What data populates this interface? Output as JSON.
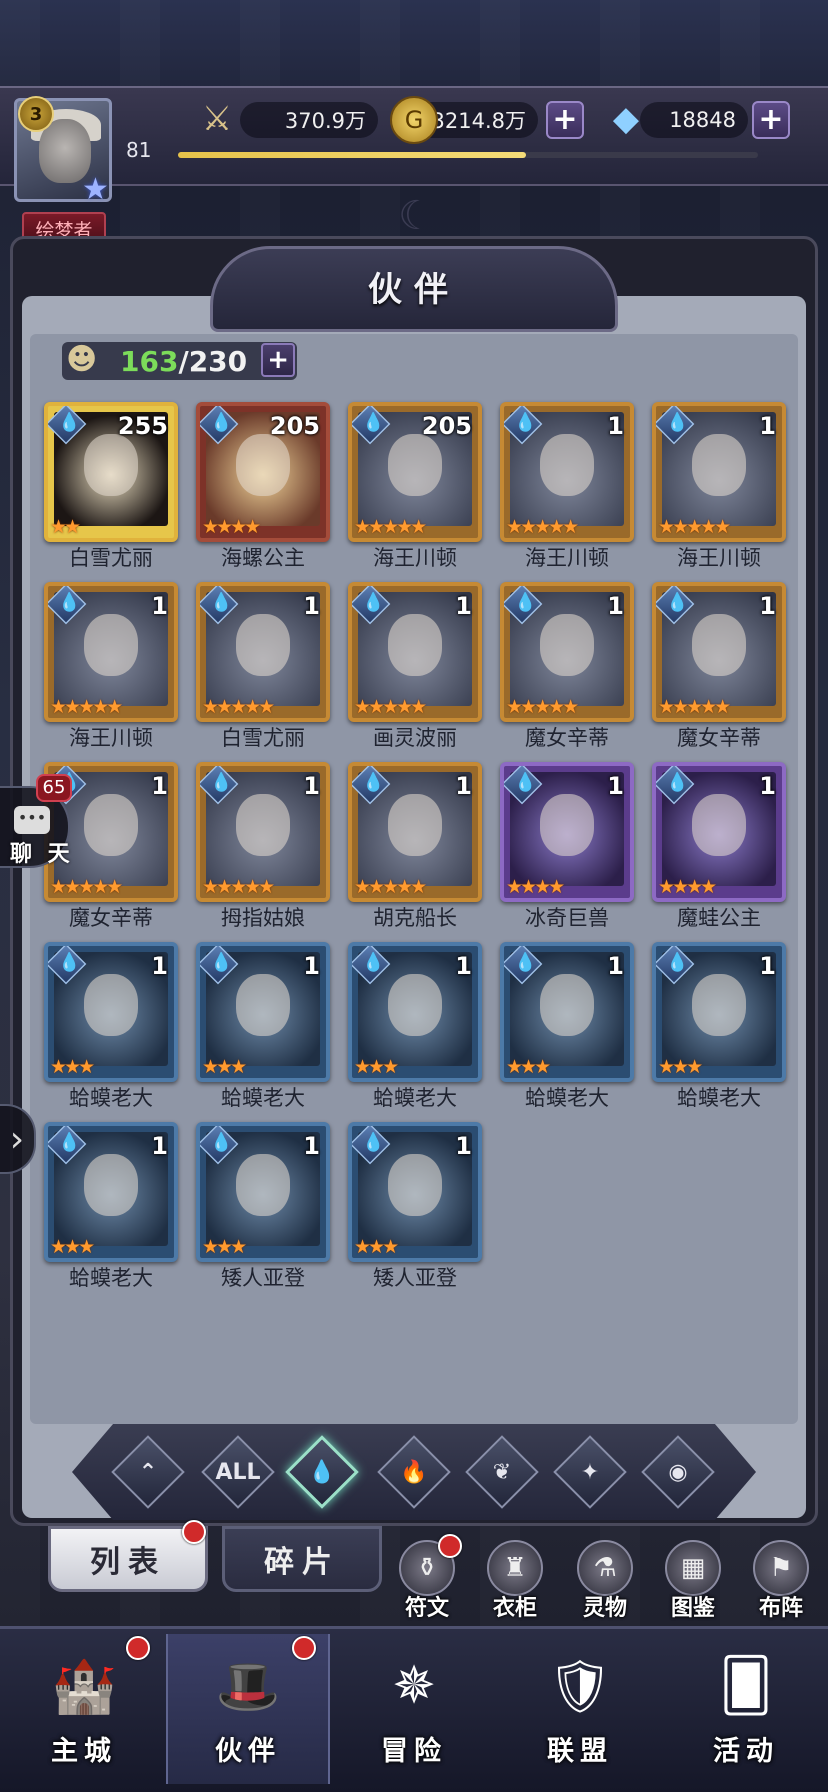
{
  "player": {
    "vip_level": "3",
    "level": "81",
    "title": "绘梦者",
    "xp_progress": 0.6
  },
  "resources": {
    "power": {
      "icon": "sword-icon",
      "value": "370.9万"
    },
    "gold": {
      "icon": "gold-coin-icon",
      "value": "3214.8万"
    },
    "gems": {
      "icon": "diamond-icon",
      "value": "18848"
    }
  },
  "panel": {
    "title": "伙伴",
    "capacity_current": "163",
    "capacity_separator": "/",
    "capacity_max": "230"
  },
  "heroes": [
    {
      "name": "白雪尤丽",
      "level": "255",
      "stars": 2,
      "rarity": "gold"
    },
    {
      "name": "海螺公主",
      "level": "205",
      "stars": 4,
      "rarity": "red"
    },
    {
      "name": "海王川顿",
      "level": "205",
      "stars": 5,
      "rarity": "orange"
    },
    {
      "name": "海王川顿",
      "level": "1",
      "stars": 5,
      "rarity": "orange"
    },
    {
      "name": "海王川顿",
      "level": "1",
      "stars": 5,
      "rarity": "orange"
    },
    {
      "name": "海王川顿",
      "level": "1",
      "stars": 5,
      "rarity": "orange"
    },
    {
      "name": "白雪尤丽",
      "level": "1",
      "stars": 5,
      "rarity": "orange"
    },
    {
      "name": "画灵波丽",
      "level": "1",
      "stars": 5,
      "rarity": "orange"
    },
    {
      "name": "魔女辛蒂",
      "level": "1",
      "stars": 5,
      "rarity": "orange"
    },
    {
      "name": "魔女辛蒂",
      "level": "1",
      "stars": 5,
      "rarity": "orange"
    },
    {
      "name": "魔女辛蒂",
      "level": "1",
      "stars": 5,
      "rarity": "orange"
    },
    {
      "name": "拇指姑娘",
      "level": "1",
      "stars": 5,
      "rarity": "orange"
    },
    {
      "name": "胡克船长",
      "level": "1",
      "stars": 5,
      "rarity": "orange"
    },
    {
      "name": "冰奇巨兽",
      "level": "1",
      "stars": 4,
      "rarity": "purple"
    },
    {
      "name": "魔蛙公主",
      "level": "1",
      "stars": 4,
      "rarity": "purple"
    },
    {
      "name": "蛤蟆老大",
      "level": "1",
      "stars": 3,
      "rarity": "blue"
    },
    {
      "name": "蛤蟆老大",
      "level": "1",
      "stars": 3,
      "rarity": "blue"
    },
    {
      "name": "蛤蟆老大",
      "level": "1",
      "stars": 3,
      "rarity": "blue"
    },
    {
      "name": "蛤蟆老大",
      "level": "1",
      "stars": 3,
      "rarity": "blue"
    },
    {
      "name": "蛤蟆老大",
      "level": "1",
      "stars": 3,
      "rarity": "blue"
    },
    {
      "name": "蛤蟆老大",
      "level": "1",
      "stars": 3,
      "rarity": "blue"
    },
    {
      "name": "矮人亚登",
      "level": "1",
      "stars": 3,
      "rarity": "blue"
    },
    {
      "name": "矮人亚登",
      "level": "1",
      "stars": 3,
      "rarity": "blue"
    }
  ],
  "chat": {
    "badge_count": "65",
    "label": "聊 天"
  },
  "filters": [
    {
      "icon": "wind-element-icon",
      "label": ""
    },
    {
      "icon": "all-filter-icon",
      "label": "ALL"
    },
    {
      "icon": "water-element-icon",
      "label": ""
    },
    {
      "icon": "fire-element-icon",
      "label": ""
    },
    {
      "icon": "nature-element-icon",
      "label": ""
    },
    {
      "icon": "light-element-icon",
      "label": ""
    },
    {
      "icon": "dark-element-icon",
      "label": ""
    }
  ],
  "tabs": {
    "list": "列表",
    "fragments": "碎片"
  },
  "shortcuts": [
    {
      "label": "符文",
      "icon": "rune-icon"
    },
    {
      "label": "衣柜",
      "icon": "wardrobe-icon"
    },
    {
      "label": "灵物",
      "icon": "spirit-icon"
    },
    {
      "label": "图鉴",
      "icon": "codex-icon"
    },
    {
      "label": "布阵",
      "icon": "formation-icon"
    }
  ],
  "nav": [
    {
      "label": "主城",
      "icon": "castle-icon"
    },
    {
      "label": "伙伴",
      "icon": "witch-hat-icon"
    },
    {
      "label": "冒险",
      "icon": "compass-icon"
    },
    {
      "label": "联盟",
      "icon": "shield-icon"
    },
    {
      "label": "活动",
      "icon": "cards-icon"
    }
  ],
  "colors": {
    "star": "#ff9a2e",
    "capacity_current": "#7cdc5a",
    "notification": "#d02a2a"
  }
}
